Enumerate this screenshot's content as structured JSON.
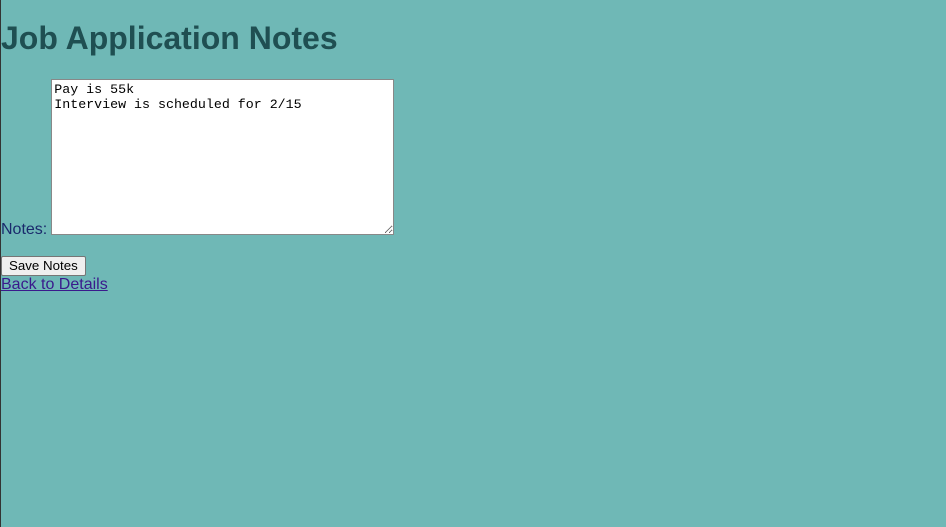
{
  "page": {
    "title": "Job Application Notes"
  },
  "form": {
    "notes_label": "Notes:",
    "notes_value": "Pay is 55k\nInterview is scheduled for 2/15",
    "save_label": "Save Notes"
  },
  "nav": {
    "back_label": "Back to Details"
  },
  "colors": {
    "background": "#6fb8b6",
    "heading": "#1f4f52",
    "label": "#1a2a6c",
    "link": "#3a1a8c"
  }
}
